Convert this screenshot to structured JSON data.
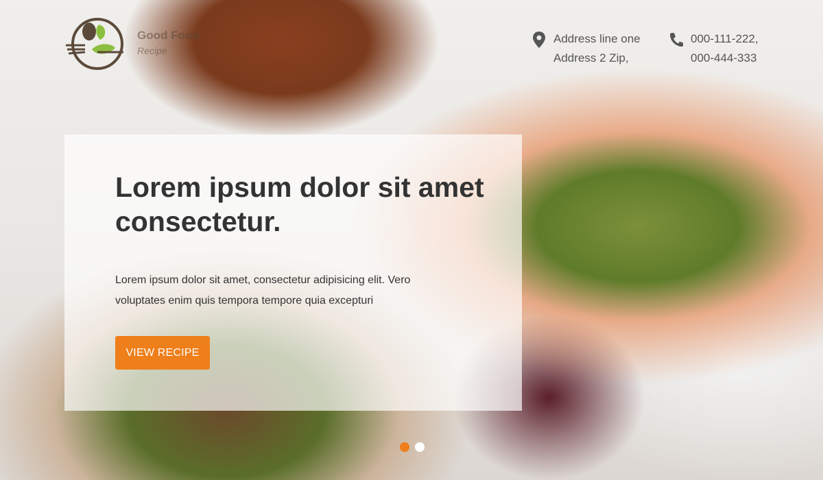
{
  "brand": {
    "name": "Good Food",
    "tagline": "Recipe"
  },
  "contact": {
    "address": {
      "line1": "Address line one",
      "line2": "Address 2 Zip,"
    },
    "phone": {
      "line1": "000-111-222,",
      "line2": "000-444-333"
    }
  },
  "hero": {
    "headline": "Lorem ipsum dolor sit amet consectetur.",
    "description": "Lorem ipsum dolor sit amet, consectetur adipisicing elit. Vero voluptates enim quis tempora tempore quia excepturi",
    "cta_label": "VIEW RECIPE"
  },
  "slider": {
    "active_index": 0,
    "count": 2
  },
  "colors": {
    "accent": "#ef7f1a",
    "logo_green": "#8cbf3f",
    "logo_brown": "#5b4a3a"
  },
  "icons": {
    "address": "location-pin-icon",
    "phone": "phone-icon"
  }
}
